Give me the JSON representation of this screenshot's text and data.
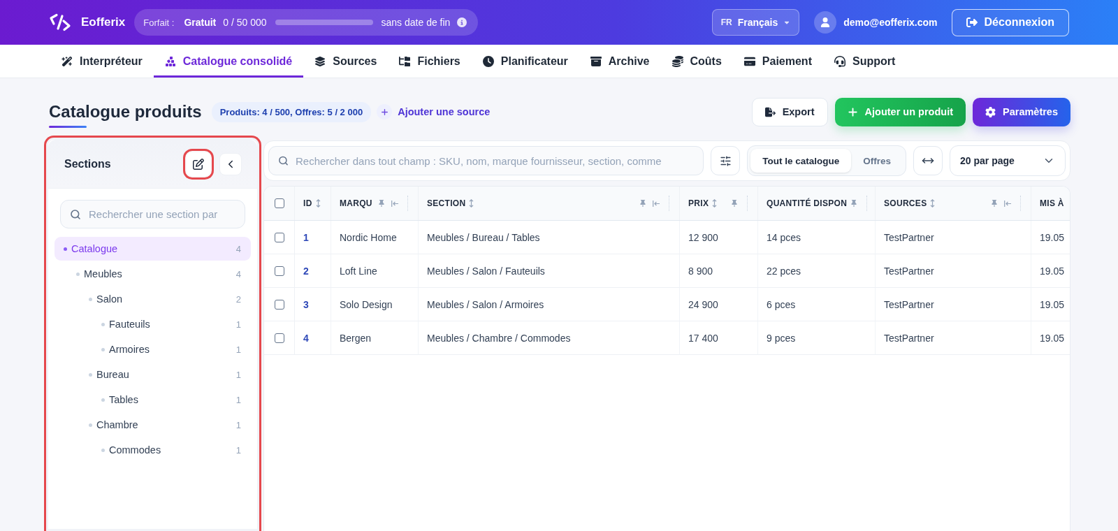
{
  "header": {
    "brand": "Eofferix",
    "plan": {
      "label": "Forfait :",
      "name": "Gratuit",
      "usage": "0 / 50 000",
      "term": "sans date de fin"
    },
    "language": {
      "code": "FR",
      "name": "Français"
    },
    "user": {
      "email": "demo@eofferix.com"
    },
    "logout": "Déconnexion"
  },
  "nav": [
    {
      "label": "Interpréteur",
      "selected": false
    },
    {
      "label": "Catalogue consolidé",
      "selected": true
    },
    {
      "label": "Sources",
      "selected": false
    },
    {
      "label": "Fichiers",
      "selected": false
    },
    {
      "label": "Planificateur",
      "selected": false
    },
    {
      "label": "Archive",
      "selected": false
    },
    {
      "label": "Coûts",
      "selected": false
    },
    {
      "label": "Paiement",
      "selected": false
    },
    {
      "label": "Support",
      "selected": false
    }
  ],
  "page": {
    "title": "Catalogue produits",
    "quota": "Produits: 4 / 500, Offres: 5 / 2 000",
    "add_source": "Ajouter une source",
    "actions": [
      {
        "kind": "export",
        "label": "Export"
      },
      {
        "kind": "add",
        "label": "Ajouter un produit"
      },
      {
        "kind": "settings",
        "label": "Paramètres"
      }
    ]
  },
  "sidebar": {
    "title": "Sections",
    "highlighted": true,
    "edit_button": {
      "highlighted": true
    },
    "search": {
      "placeholder": "Rechercher une section par"
    },
    "tree": [
      {
        "label": "Catalogue",
        "count": "4",
        "selected": true,
        "children": [
          {
            "label": "Meubles",
            "count": "4",
            "selected": false,
            "children": [
              {
                "label": "Salon",
                "count": "2",
                "selected": false,
                "children": [
                  {
                    "label": "Fauteuils",
                    "count": "1",
                    "selected": false
                  },
                  {
                    "label": "Armoires",
                    "count": "1",
                    "selected": false
                  }
                ]
              },
              {
                "label": "Bureau",
                "count": "1",
                "selected": false,
                "children": [
                  {
                    "label": "Tables",
                    "count": "1",
                    "selected": false
                  }
                ]
              },
              {
                "label": "Chambre",
                "count": "1",
                "selected": false,
                "children": [
                  {
                    "label": "Commodes",
                    "count": "1",
                    "selected": false
                  }
                ]
              }
            ]
          }
        ]
      }
    ]
  },
  "toolbar": {
    "search": {
      "placeholder": "Rechercher dans tout champ : SKU, nom, marque fournisseur, section, comme"
    },
    "views": [
      {
        "label": "Tout le catalogue",
        "selected": true
      },
      {
        "label": "Offres",
        "selected": false
      }
    ],
    "per_page": "20 par page"
  },
  "table": {
    "select_all": {
      "checked": false
    },
    "columns": [
      {
        "label": "ID",
        "sortable": true,
        "pinnable": false,
        "collapsible": false
      },
      {
        "label": "MARQU",
        "sortable": false,
        "pinnable": true,
        "collapsible": true
      },
      {
        "label": "SECTION",
        "sortable": true,
        "pinnable": true,
        "collapsible": true
      },
      {
        "label": "PRIX",
        "sortable": true,
        "pinnable": true,
        "collapsible": false
      },
      {
        "label": "QUANTITÉ DISPON",
        "sortable": false,
        "pinnable": true,
        "collapsible": false
      },
      {
        "label": "SOURCES",
        "sortable": true,
        "pinnable": true,
        "collapsible": true
      },
      {
        "label": "MIS À",
        "sortable": false,
        "pinnable": false,
        "collapsible": false
      }
    ],
    "rows": [
      {
        "checked": false,
        "cells": [
          "1",
          "Nordic Home",
          "Meubles / Bureau / Tables",
          "12 900",
          "14 pces",
          "TestPartner",
          "19.05"
        ]
      },
      {
        "checked": false,
        "cells": [
          "2",
          "Loft Line",
          "Meubles / Salon / Fauteuils",
          "8 900",
          "22 pces",
          "TestPartner",
          "19.05"
        ]
      },
      {
        "checked": false,
        "cells": [
          "3",
          "Solo Design",
          "Meubles / Salon / Armoires",
          "24 900",
          "6 pces",
          "TestPartner",
          "19.05"
        ]
      },
      {
        "checked": false,
        "cells": [
          "4",
          "Bergen",
          "Meubles / Chambre / Commodes",
          "17 400",
          "9 pces",
          "TestPartner",
          "19.05"
        ]
      }
    ]
  }
}
